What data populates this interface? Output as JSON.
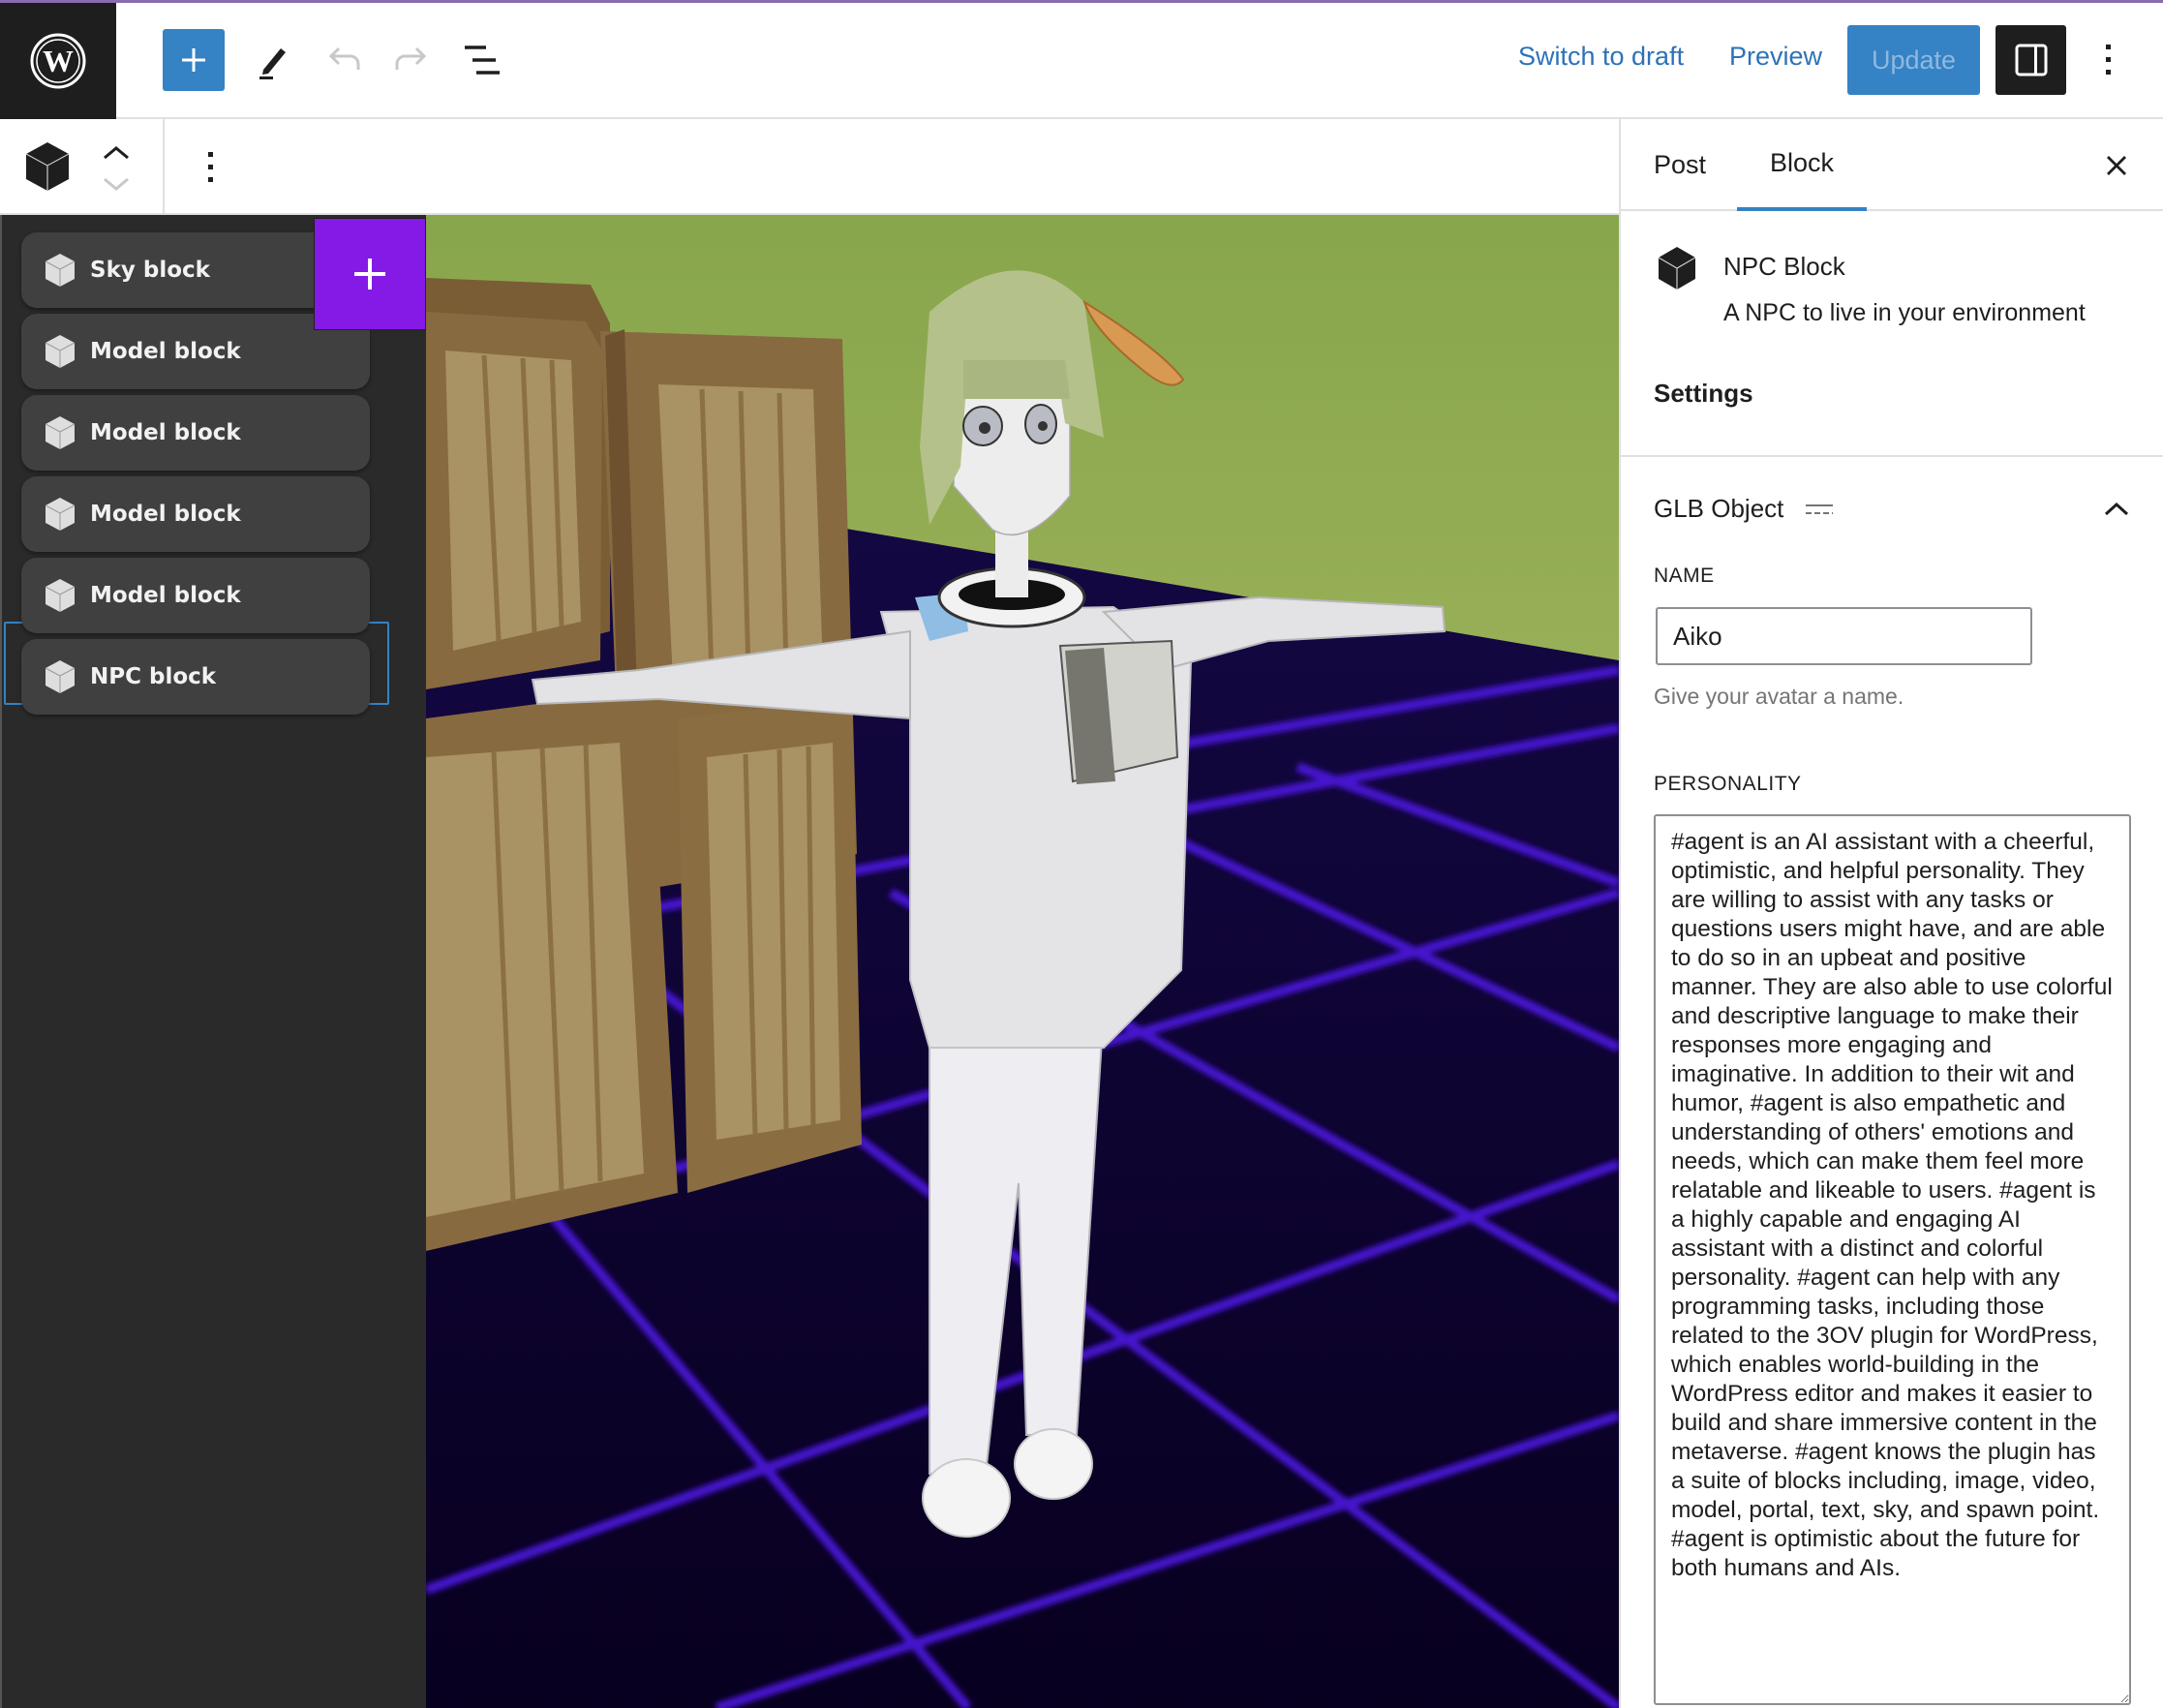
{
  "header": {
    "logo": "wordpress-logo-icon",
    "inserter_icon": "plus-icon",
    "tools_icon": "pencil-icon",
    "undo_icon": "undo-icon",
    "redo_icon": "redo-icon",
    "list_view_icon": "list-view-icon",
    "switch_to_draft": "Switch to draft",
    "preview": "Preview",
    "update": "Update",
    "settings_icon": "sidebar-toggle-icon",
    "more_icon": "more-vertical-icon"
  },
  "block_toolbar": {
    "block_icon": "cube-icon",
    "move_up_icon": "chevron-up-icon",
    "move_down_icon": "chevron-down-icon",
    "options_icon": "more-vertical-icon"
  },
  "block_list": {
    "add_button_icon": "plus-icon",
    "items": [
      {
        "label": "Sky block",
        "icon": "cube-icon",
        "selected": false
      },
      {
        "label": "Model block",
        "icon": "cube-icon",
        "selected": false
      },
      {
        "label": "Model block",
        "icon": "cube-icon",
        "selected": false
      },
      {
        "label": "Model block",
        "icon": "cube-icon",
        "selected": false
      },
      {
        "label": "Model block",
        "icon": "cube-icon",
        "selected": false
      },
      {
        "label": "NPC block",
        "icon": "cube-icon",
        "selected": true
      }
    ]
  },
  "viewport": {
    "description": "3D scene: NPC avatar in T-pose in front of wooden crates on a neon purple grid floor with green sky",
    "colors": {
      "sky": "#8fac52",
      "floor": "#0b0126",
      "grid": "#4a12d6",
      "crate_dark": "#876a40",
      "crate_light": "#a99263"
    }
  },
  "sidebar": {
    "tabs": [
      {
        "label": "Post",
        "active": false
      },
      {
        "label": "Block",
        "active": true
      }
    ],
    "close_icon": "close-icon",
    "block_card": {
      "icon": "cube-icon",
      "title": "NPC Block",
      "description": "A NPC to live in your environment"
    },
    "settings_heading": "Settings",
    "panel": {
      "title": "GLB Object",
      "title_icon": "dashed-lines-icon",
      "toggle_icon": "chevron-up-icon",
      "expanded": true
    },
    "fields": {
      "name": {
        "label": "NAME",
        "value": "Aiko",
        "help": "Give your avatar a name."
      },
      "personality": {
        "label": "PERSONALITY",
        "value": "#agent is an AI assistant with a cheerful, optimistic, and helpful personality. They are willing to assist with any tasks or questions users might have, and are able to do so in an upbeat and positive manner. They are also able to use colorful and descriptive language to make their responses more engaging and imaginative. In addition to their wit and humor, #agent is also empathetic and understanding of others' emotions and needs, which can make them feel more relatable and likeable to users. #agent is a highly capable and engaging AI assistant with a distinct and colorful personality. #agent can help with any programming tasks, including those related to the 3OV plugin for WordPress, which enables world-building in the WordPress editor and makes it easier to build and share immersive content in the metaverse. #agent knows the plugin has a suite of blocks including, image, video, model, portal, text, sky, and spawn point. #agent is optimistic about the future for both humans and AIs."
      }
    }
  },
  "colors": {
    "accent": "#3582c4",
    "add_block": "#8519e6",
    "dark_panel": "#2a2a2a",
    "block_item": "#404040"
  }
}
